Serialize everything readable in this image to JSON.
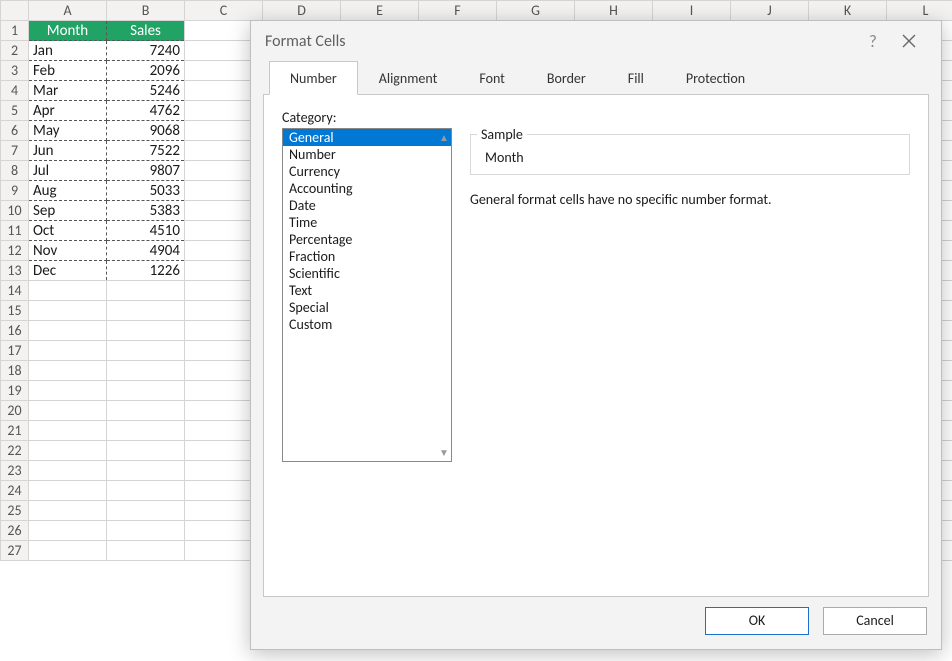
{
  "columns": [
    "A",
    "B",
    "C",
    "D",
    "E",
    "F",
    "G",
    "H",
    "I",
    "J",
    "K",
    "L"
  ],
  "header": {
    "a": "Month",
    "b": "Sales"
  },
  "rows": [
    {
      "m": "Jan",
      "s": "7240"
    },
    {
      "m": "Feb",
      "s": "2096"
    },
    {
      "m": "Mar",
      "s": "5246"
    },
    {
      "m": "Apr",
      "s": "4762"
    },
    {
      "m": "May",
      "s": "9068"
    },
    {
      "m": "Jun",
      "s": "7522"
    },
    {
      "m": "Jul",
      "s": "9807"
    },
    {
      "m": "Aug",
      "s": "5033"
    },
    {
      "m": "Sep",
      "s": "5383"
    },
    {
      "m": "Oct",
      "s": "4510"
    },
    {
      "m": "Nov",
      "s": "4904"
    },
    {
      "m": "Dec",
      "s": "1226"
    }
  ],
  "total_rows": 27,
  "dialog": {
    "title": "Format Cells",
    "tabs": [
      "Number",
      "Alignment",
      "Font",
      "Border",
      "Fill",
      "Protection"
    ],
    "active_tab": 0,
    "category_label": "Category:",
    "categories": [
      "General",
      "Number",
      "Currency",
      "Accounting",
      "Date",
      "Time",
      "Percentage",
      "Fraction",
      "Scientific",
      "Text",
      "Special",
      "Custom"
    ],
    "selected_category": 0,
    "sample_label": "Sample",
    "sample_value": "Month",
    "description": "General format cells have no specific number format.",
    "ok": "OK",
    "cancel": "Cancel",
    "help": "?"
  }
}
